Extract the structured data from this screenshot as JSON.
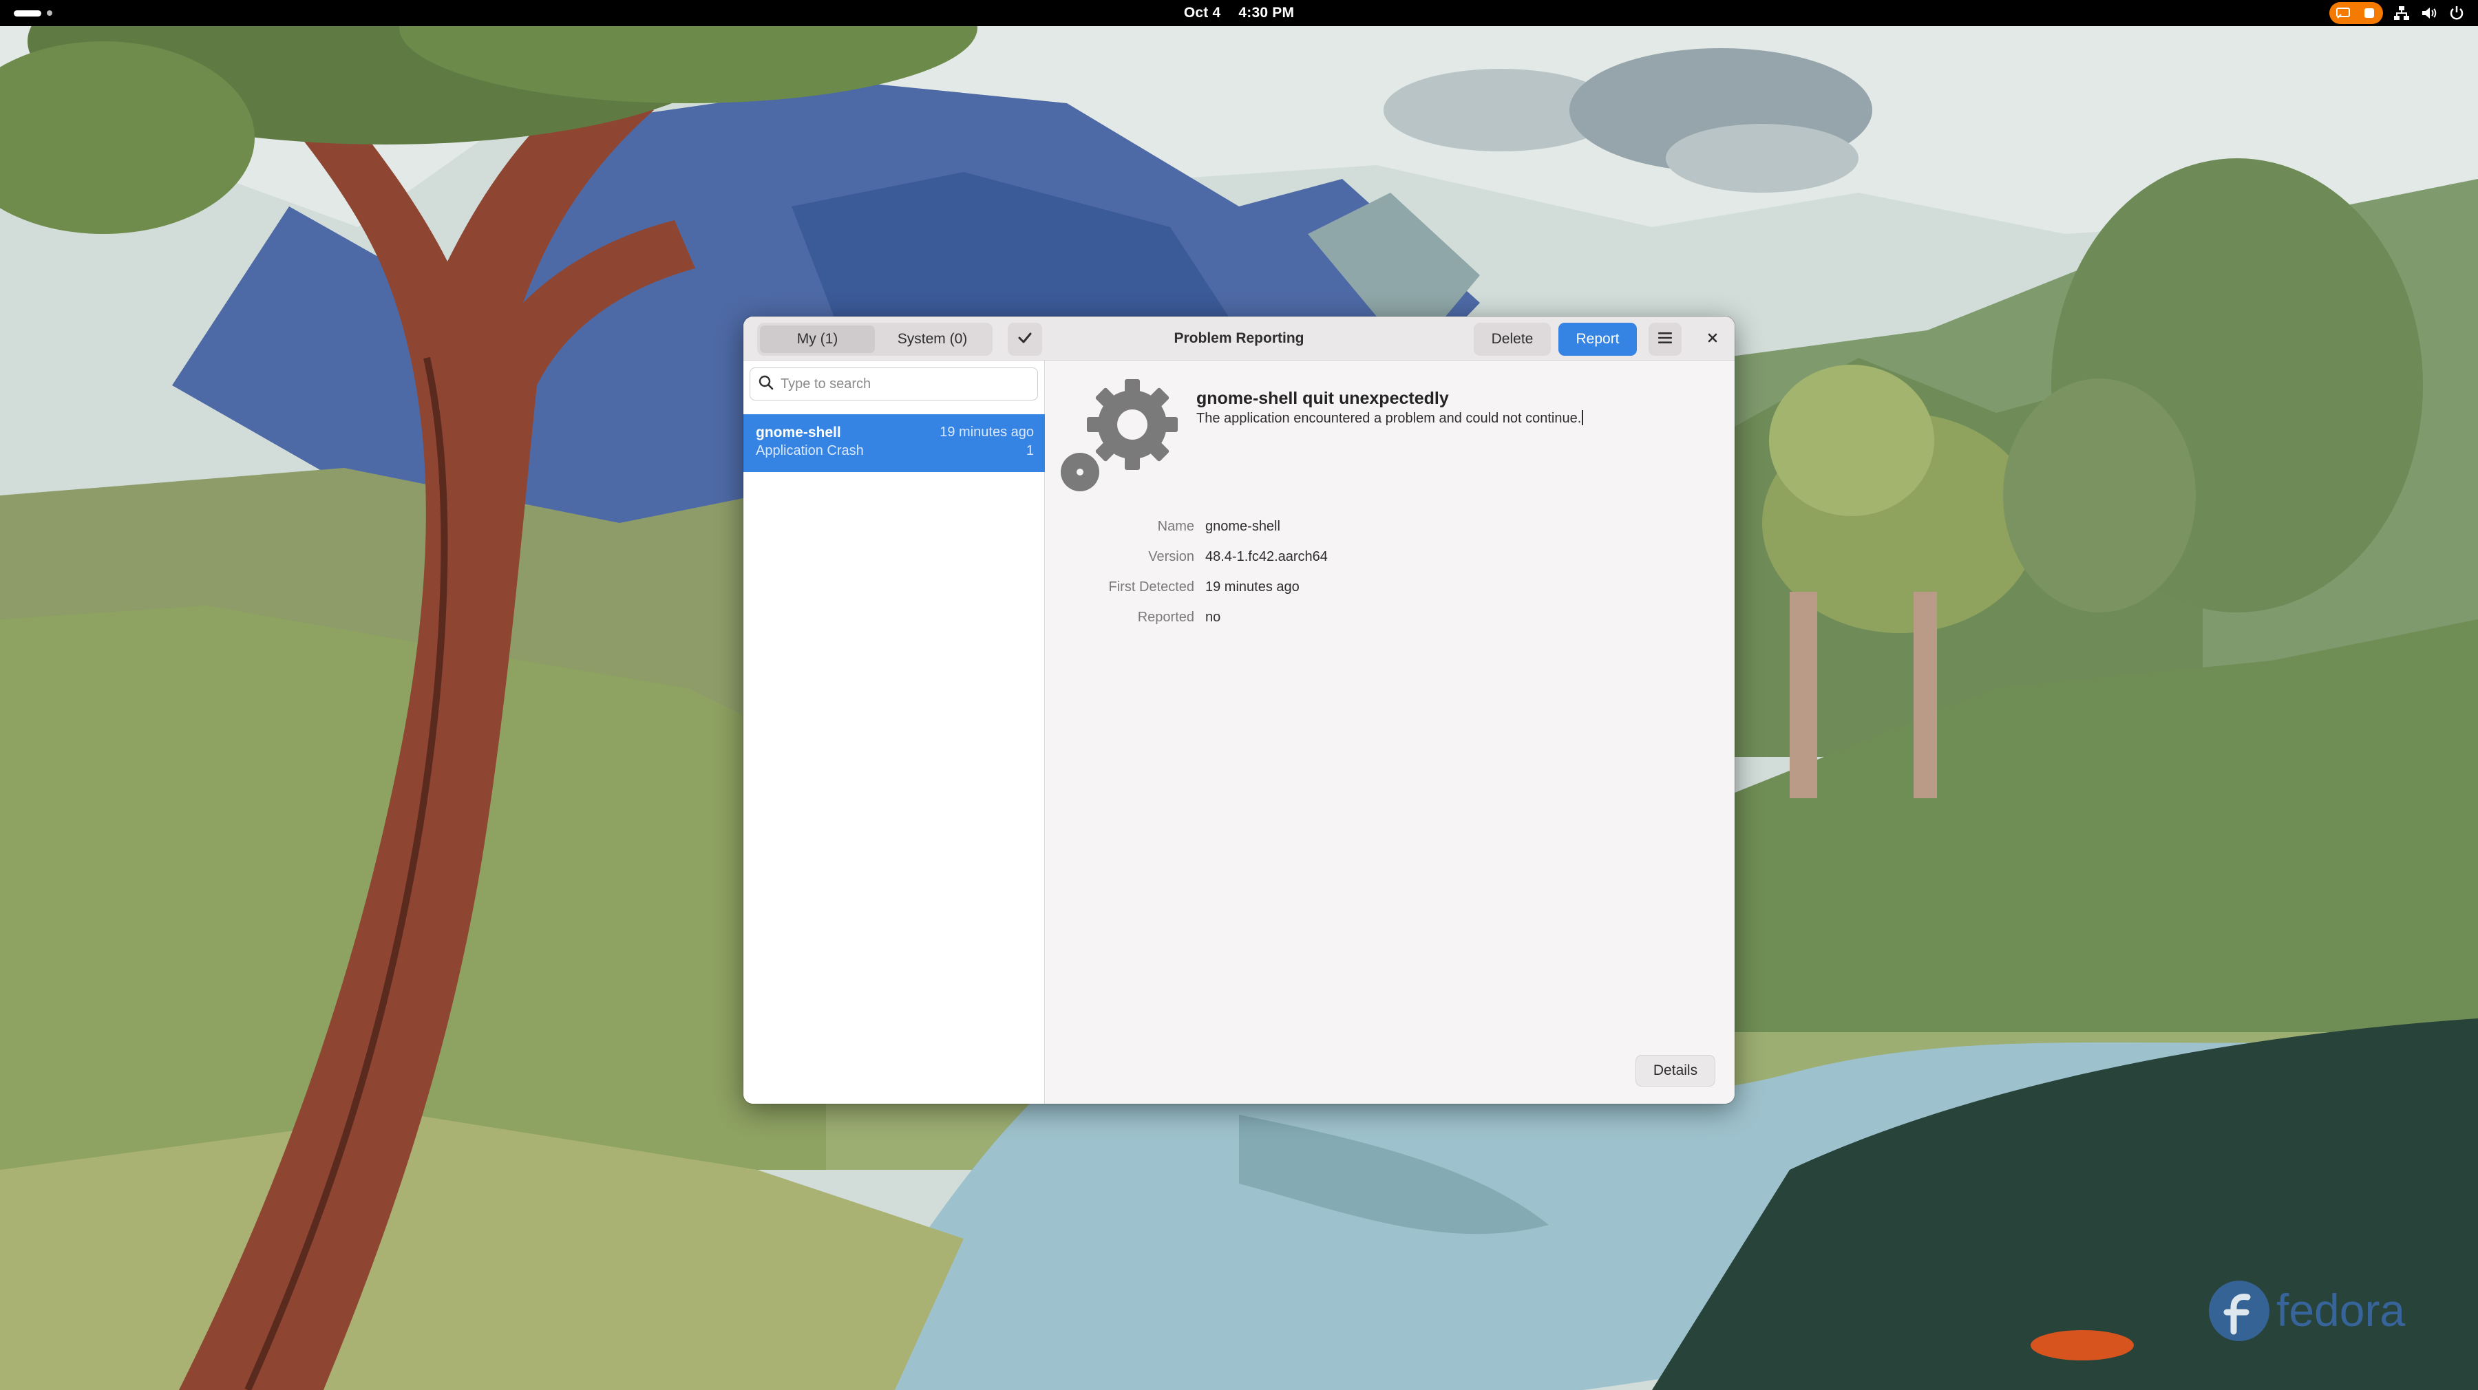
{
  "topbar": {
    "date": "Oct 4",
    "time": "4:30 PM",
    "tray_icons": [
      "screen-share-icon",
      "recording-stop-icon",
      "network-wired-icon",
      "volume-icon",
      "power-icon"
    ]
  },
  "window": {
    "title": "Problem Reporting",
    "tabs": [
      {
        "label": "My (1)",
        "active": true
      },
      {
        "label": "System (0)",
        "active": false
      }
    ],
    "delete_label": "Delete",
    "report_label": "Report",
    "details_label": "Details"
  },
  "sidebar": {
    "search_placeholder": "Type to search",
    "problems": [
      {
        "name": "gnome-shell",
        "type": "Application Crash",
        "time": "19 minutes ago",
        "count": "1",
        "selected": true
      }
    ]
  },
  "main": {
    "title": "gnome-shell quit unexpectedly",
    "description": "The application encountered a problem and could not continue.",
    "info": [
      {
        "label": "Name",
        "value": "gnome-shell"
      },
      {
        "label": "Version",
        "value": "48.4-1.fc42.aarch64"
      },
      {
        "label": "First Detected",
        "value": "19 minutes ago"
      },
      {
        "label": "Reported",
        "value": "no"
      }
    ]
  },
  "wallpaper": {
    "logo_text": "fedora"
  },
  "colors": {
    "accent": "#3584e4",
    "topbar": "#000000",
    "tray_indicator": "#f57a00"
  }
}
